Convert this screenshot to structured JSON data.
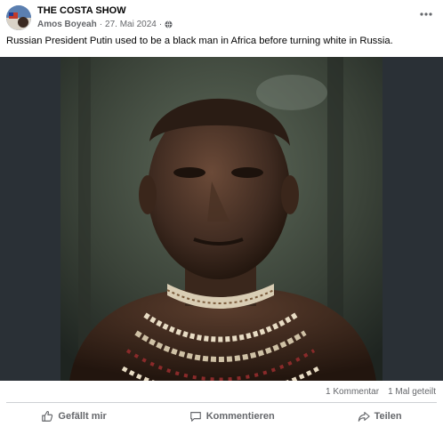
{
  "post": {
    "page_name": "THE COSTA SHOW",
    "author": "Amos Boyeah",
    "separator": "·",
    "date": "27. Mai 2024",
    "meta_dot": "·",
    "text": "Russian President Putin used to be a black man in Africa before turning white in Russia."
  },
  "stats": {
    "comments": "1 Kommentar",
    "shares": "1 Mal geteilt"
  },
  "actions": {
    "like": "Gefällt mir",
    "comment": "Kommentieren",
    "share": "Teilen"
  },
  "colors": {
    "secondary_text": "#65676b",
    "divider": "#ced0d4"
  }
}
